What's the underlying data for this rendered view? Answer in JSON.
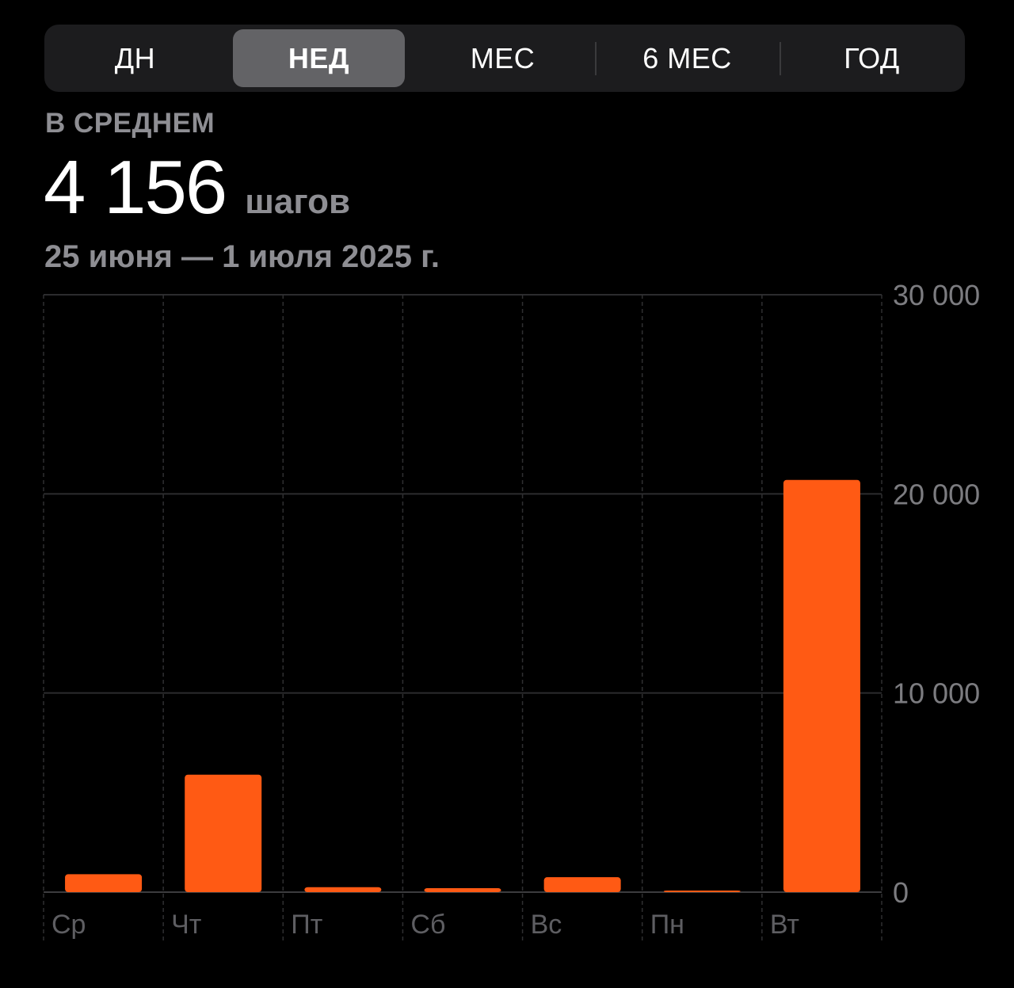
{
  "tabs": [
    {
      "label": "ДН",
      "active": false
    },
    {
      "label": "НЕД",
      "active": true
    },
    {
      "label": "МЕС",
      "active": false
    },
    {
      "label": "6 МЕС",
      "active": false
    },
    {
      "label": "ГОД",
      "active": false
    }
  ],
  "summary": {
    "avg_label": "В СРЕДНЕМ",
    "avg_value": "4 156",
    "avg_unit": "шагов",
    "date_range": "25 июня — 1 июля 2025 г."
  },
  "colors": {
    "bar": "#ff5a14",
    "background": "#000000"
  },
  "chart_data": {
    "type": "bar",
    "categories": [
      "Ср",
      "Чт",
      "Пт",
      "Сб",
      "Вс",
      "Пн",
      "Вт"
    ],
    "values": [
      900,
      5900,
      250,
      200,
      750,
      60,
      20700
    ],
    "ylim": [
      0,
      30000
    ],
    "yticks": [
      0,
      10000,
      20000,
      30000
    ],
    "ytick_labels": [
      "0",
      "10 000",
      "20 000",
      "30 000"
    ],
    "grid": true,
    "y_axis_position": "right"
  }
}
